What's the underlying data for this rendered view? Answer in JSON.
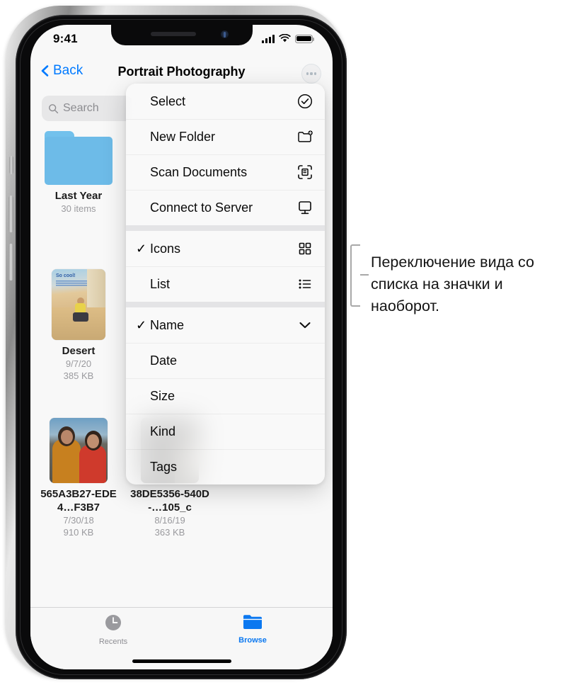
{
  "device": {
    "notch": {
      "speaker": "speaker-grille",
      "camera": "front-camera"
    }
  },
  "status_bar": {
    "time": "9:41",
    "cellular_icon": "signal-bars-icon",
    "wifi_icon": "wifi-icon",
    "battery_icon": "battery-full-icon"
  },
  "nav_bar": {
    "back_label": "Back",
    "back_icon": "chevron-left-icon",
    "title": "Portrait Photography",
    "more_button_icon": "ellipsis-circle-icon"
  },
  "search": {
    "placeholder": "Search",
    "icon": "search-icon"
  },
  "files": [
    {
      "name": "Last Year",
      "meta1": "30 items",
      "meta2": "",
      "kind": "folder",
      "icon": "folder-icon"
    },
    {
      "name": "Desert",
      "meta1": "9/7/20",
      "meta2": "385 KB",
      "kind": "image",
      "icon": "photo-thumbnail"
    },
    {
      "name": "565A3B27-EDE4…F3B7",
      "meta1": "7/30/18",
      "meta2": "910 KB",
      "kind": "image",
      "icon": "photo-thumbnail"
    },
    {
      "name": "38DE5356-540D-…105_c",
      "meta1": "8/16/19",
      "meta2": "363 KB",
      "kind": "image",
      "icon": "photo-thumbnail"
    }
  ],
  "context_menu": {
    "groups": [
      {
        "items": [
          {
            "label": "Select",
            "icon": "checkmark-circle-icon",
            "checked": false
          },
          {
            "label": "New Folder",
            "icon": "folder-badge-plus-icon",
            "checked": false
          },
          {
            "label": "Scan Documents",
            "icon": "scan-document-icon",
            "checked": false
          },
          {
            "label": "Connect to Server",
            "icon": "server-display-icon",
            "checked": false
          }
        ]
      },
      {
        "items": [
          {
            "label": "Icons",
            "icon": "grid-icon",
            "checked": true
          },
          {
            "label": "List",
            "icon": "list-bullet-icon",
            "checked": false
          }
        ]
      },
      {
        "items": [
          {
            "label": "Name",
            "icon": "chevron-down-icon",
            "checked": true
          },
          {
            "label": "Date",
            "icon": "",
            "checked": false
          },
          {
            "label": "Size",
            "icon": "",
            "checked": false
          },
          {
            "label": "Kind",
            "icon": "",
            "checked": false
          },
          {
            "label": "Tags",
            "icon": "",
            "checked": false
          }
        ]
      }
    ],
    "checkmark_glyph": "✓"
  },
  "tab_bar": {
    "tabs": [
      {
        "label": "Recents",
        "icon": "clock-icon",
        "selected": false
      },
      {
        "label": "Browse",
        "icon": "folder-icon",
        "selected": true
      }
    ]
  },
  "callout": {
    "text": "Переключение вида со списка на значки и наоборот."
  },
  "colors": {
    "accent_blue": "#007aff",
    "tab_active_blue": "#0b78f0",
    "folder_blue": "#6dbbe8",
    "muted_gray": "#8e8e93",
    "callout_gray": "#a8a8a8"
  }
}
